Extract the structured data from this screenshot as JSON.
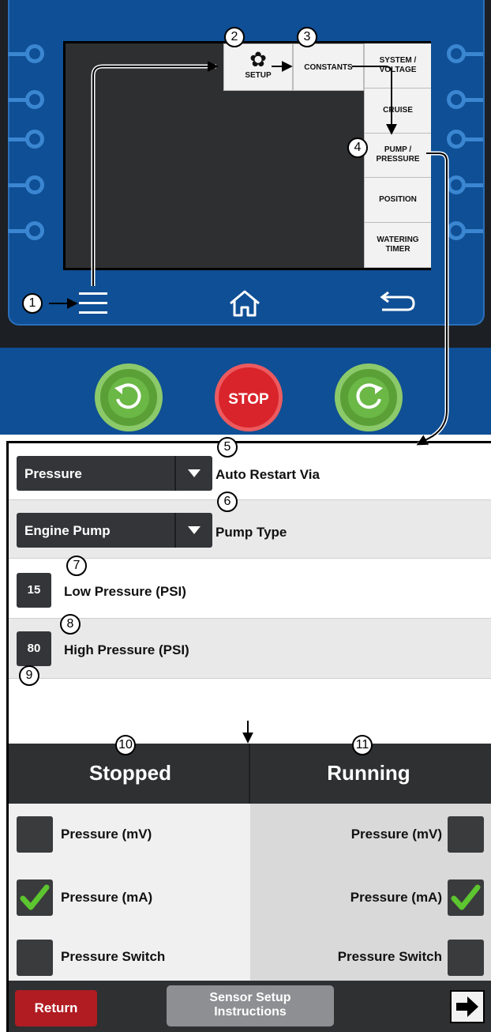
{
  "controller": {
    "setup_label": "SETUP",
    "constants_label": "CONSTANTS",
    "menu_items": [
      {
        "label": "SYSTEM /\nVOLTAGE"
      },
      {
        "label": "CRUISE"
      },
      {
        "label": "PUMP /\nPRESSURE"
      },
      {
        "label": "POSITION"
      },
      {
        "label": "WATERING\nTIMER"
      }
    ],
    "stop_label": "STOP",
    "icons": [
      "gear-icon",
      "menu-icon",
      "home-icon",
      "back-icon",
      "rotate-left-icon",
      "rotate-right-icon"
    ]
  },
  "callouts": [
    "1",
    "2",
    "3",
    "4",
    "5",
    "6",
    "7",
    "8",
    "9",
    "10",
    "11"
  ],
  "settings": {
    "auto_restart": {
      "value": "Pressure",
      "label": "Auto Restart Via"
    },
    "pump_type": {
      "value": "Engine Pump",
      "label": "Pump Type"
    },
    "low_pressure": {
      "value": "15",
      "label": "Low Pressure (PSI)"
    },
    "high_pressure": {
      "value": "80",
      "label": "High Pressure (PSI)"
    }
  },
  "columns": {
    "stopped": "Stopped",
    "running": "Running"
  },
  "sensors": [
    {
      "label": "Pressure (mV)",
      "stopped_checked": false,
      "running_checked": false
    },
    {
      "label": "Pressure (mA)",
      "stopped_checked": true,
      "running_checked": true
    },
    {
      "label": "Pressure Switch",
      "stopped_checked": false,
      "running_checked": false
    }
  ],
  "footer": {
    "return_label": "Return",
    "sensor_setup_label": "Sensor Setup\nInstructions"
  },
  "colors": {
    "panel_blue": "#0f4f95",
    "check_green": "#5cc52f",
    "return_red": "#b01c22",
    "stop_red": "#d9242b"
  }
}
